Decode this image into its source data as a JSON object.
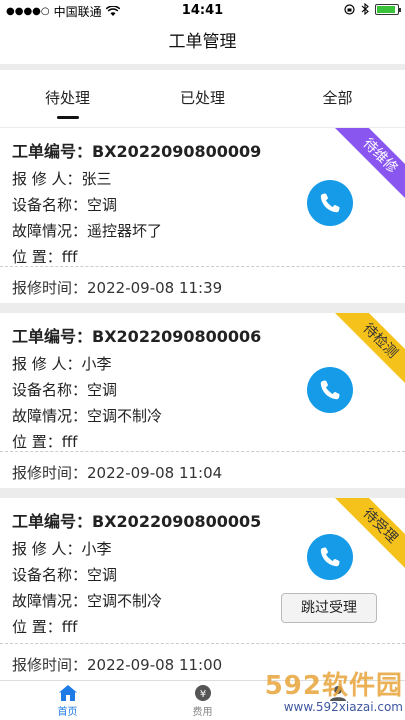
{
  "status_bar": {
    "carrier": "中国联通",
    "time": "14:41"
  },
  "nav": {
    "title": "工单管理"
  },
  "tabs": [
    {
      "label": "待处理",
      "active": true
    },
    {
      "label": "已处理",
      "active": false
    },
    {
      "label": "全部",
      "active": false
    }
  ],
  "labels": {
    "order_no": "工单编号：",
    "reporter": "报 修 人：",
    "device": "设备名称：",
    "fault": "故障情况：",
    "location": "位    置：",
    "report_time": "报修时间："
  },
  "orders": [
    {
      "order_no": "BX2022090800009",
      "reporter": "张三",
      "device": "空调",
      "fault": "遥控器坏了",
      "location": "fff",
      "report_time": "2022-09-08 11:39",
      "status": "待维修",
      "status_color": "#8a56f0"
    },
    {
      "order_no": "BX2022090800006",
      "reporter": "小李",
      "device": "空调",
      "fault": "空调不制冷",
      "location": "fff",
      "report_time": "2022-09-08 11:04",
      "status": "待检测",
      "status_color": "#f5c21b"
    },
    {
      "order_no": "BX2022090800005",
      "reporter": "小李",
      "device": "空调",
      "fault": "空调不制冷",
      "location": "fff",
      "report_time": "2022-09-08 11:00",
      "status": "待受理",
      "status_color": "#f5c21b",
      "skip_label": "跳过受理"
    }
  ],
  "tabbar": [
    {
      "label": "首页",
      "icon": "home-icon",
      "active": true
    },
    {
      "label": "费用",
      "icon": "fee-icon",
      "active": false
    },
    {
      "label": "",
      "icon": "profile-icon",
      "active": false
    }
  ],
  "watermark": {
    "brand": "592软件园",
    "url": "www.592xiazai.com"
  }
}
